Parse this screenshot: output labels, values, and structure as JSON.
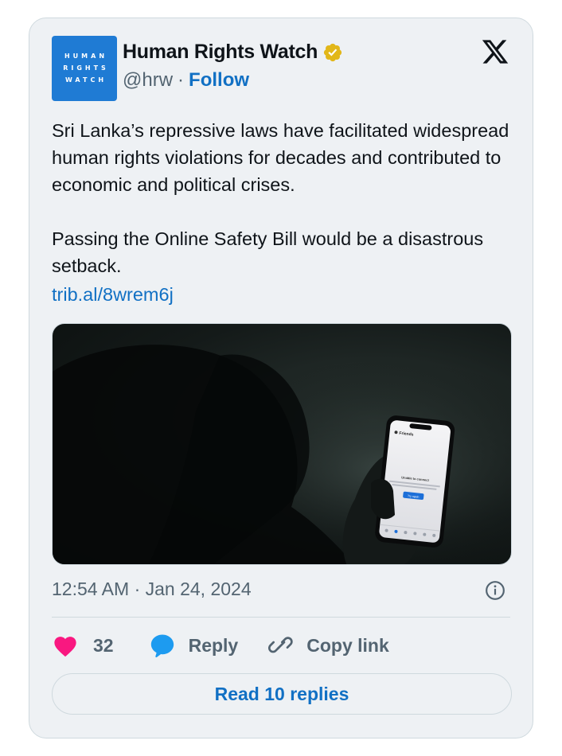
{
  "author": {
    "name": "Human Rights Watch",
    "handle": "@hrw",
    "separator": "·",
    "follow_label": "Follow",
    "avatar_lines": [
      "HUMAN",
      "RIGHTS",
      "WATCH"
    ],
    "verified_color": "#e2b719"
  },
  "tweet": {
    "paragraph_1": "Sri Lanka’s repressive laws have facilitated widespread human rights violations for decades and contributed to economic and political crises.",
    "paragraph_2": "Passing the Online Safety Bill would be a disastrous setback.",
    "link": "trib.al/8wrem6j"
  },
  "media": {
    "phone_header": "Friends",
    "phone_message": "Unable to connect",
    "phone_button": "Try again"
  },
  "meta": {
    "timestamp": "12:54 AM · Jan 24, 2024"
  },
  "actions": {
    "like_count": "32",
    "reply_label": "Reply",
    "copy_link_label": "Copy link",
    "read_replies_label": "Read 10 replies"
  },
  "icons": {
    "platform": "x-logo-icon",
    "verified": "verified-badge-icon",
    "info": "info-icon",
    "like": "heart-icon",
    "reply": "speech-bubble-icon",
    "copy": "link-icon"
  },
  "colors": {
    "accent": "#1170c4",
    "heart": "#f91880",
    "reply_bubble": "#1d9bf0",
    "card_bg": "#eef1f4",
    "avatar_bg": "#1f7bd4"
  }
}
